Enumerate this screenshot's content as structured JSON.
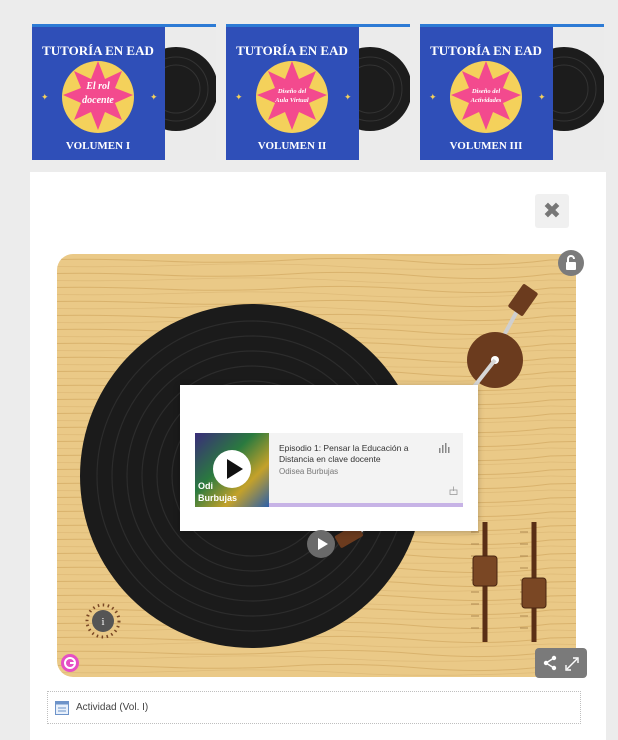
{
  "covers": [
    {
      "top_text": "TUTORÍA EN EAD",
      "center_lines": [
        "El rol",
        "docente"
      ],
      "bottom_text": "VOLUMEN I"
    },
    {
      "top_text": "TUTORÍA EN EAD",
      "center_lines": [
        "Diseño del",
        "Aula Virtual"
      ],
      "bottom_text": "VOLUMEN II"
    },
    {
      "top_text": "TUTORÍA EN EAD",
      "center_lines": [
        "Diseño del",
        "Actividades"
      ],
      "bottom_text": "VOLUMEN III"
    }
  ],
  "colors": {
    "cover_blue": "#2f4fb8",
    "star_pink": "#f34a8e",
    "sun_yellow": "#f4d15b",
    "wood": "#e9c886",
    "record": "#1a1a1a",
    "accent_blue": "#2d7bd5"
  },
  "icons": {
    "close": "close-icon",
    "play": "play-icon",
    "lock": "lock-icon",
    "info": "info-icon",
    "share": "share-icon",
    "expand": "expand-icon",
    "document": "document-icon",
    "wave": "soundwave-icon"
  },
  "close_glyph": "✖",
  "podcast": {
    "title": "Episodio 1: Pensar la Educación a Distancia en clave docente",
    "author": "Odisea Burbujas",
    "art_text": [
      "Odi",
      "Burbujas"
    ]
  },
  "info_label": "i",
  "activity": {
    "label": "Actividad (Vol. I)"
  }
}
